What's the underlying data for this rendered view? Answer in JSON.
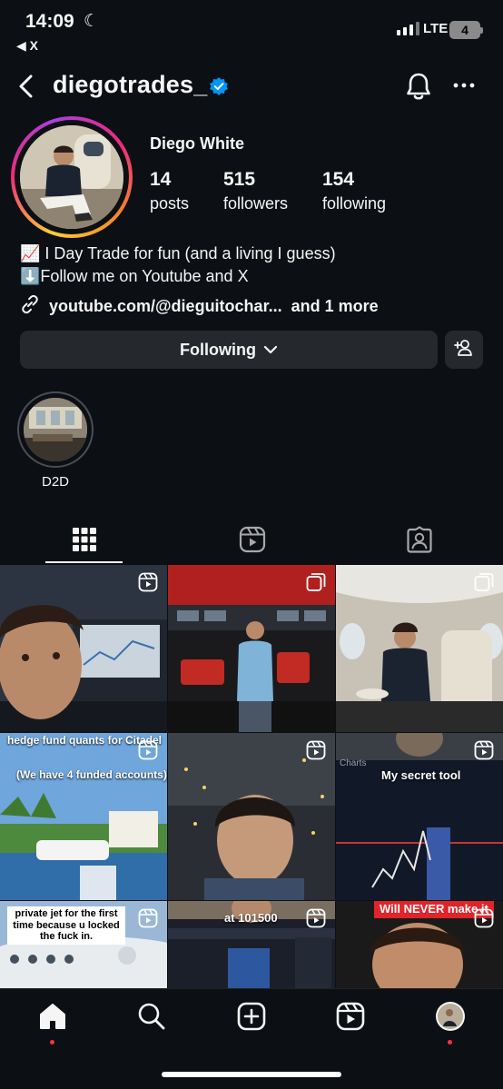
{
  "status_bar": {
    "time": "14:09",
    "back_app": "◀ X",
    "network": "LTE",
    "battery": "4"
  },
  "header": {
    "username": "diegotrades_"
  },
  "profile": {
    "name": "Diego White",
    "stats": [
      {
        "value": "14",
        "label": "posts"
      },
      {
        "value": "515",
        "label": "followers"
      },
      {
        "value": "154",
        "label": "following"
      }
    ],
    "bio_lines": [
      "📈 I Day Trade for fun (and a living I guess)",
      "⬇️Follow me on Youtube and X"
    ],
    "link": "youtube.com/@dieguitochar...",
    "link_more": "and 1 more"
  },
  "actions": {
    "following_label": "Following"
  },
  "highlights": [
    {
      "label": "D2D"
    }
  ],
  "posts": [
    {
      "overlay": ""
    },
    {
      "overlay": ""
    },
    {
      "overlay": ""
    },
    {
      "overlay_top": "hedge fund quants for Citadel",
      "overlay_mid": "(We have 4 funded accounts)"
    },
    {
      "overlay": ""
    },
    {
      "overlay_top": "Charts",
      "overlay_mid": "My secret tool"
    },
    {
      "overlay_top": "private jet for the first time because u locked the fuck in."
    },
    {
      "overlay_top": "at 101500"
    },
    {
      "overlay_top": "Will NEVER make it"
    }
  ]
}
